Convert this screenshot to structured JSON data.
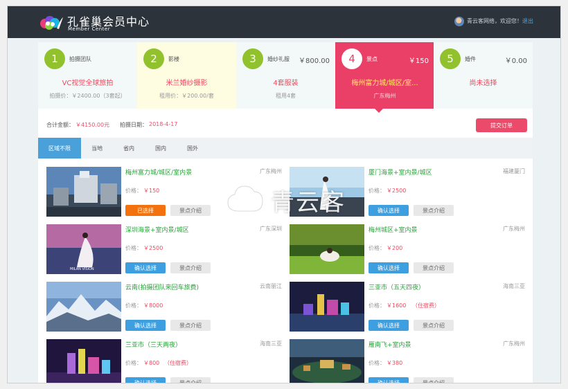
{
  "header": {
    "brand_title": "孔雀巢会员中心",
    "brand_sub": "Member Center",
    "welcome": "青云客网络，欢迎您！",
    "logout": "退出"
  },
  "steps": [
    {
      "num": "1",
      "title": "拍摄团队",
      "price": "",
      "selection": "VC视觉全球旅拍",
      "sub": "拍摄价：￥2400.00（3套起）",
      "color": "#91c12c",
      "bg": "#f2f9f8",
      "sel_color": "#e84b60"
    },
    {
      "num": "2",
      "title": "影楼",
      "price": "",
      "selection": "米兰婚纱摄影",
      "sub": "租用价：￥200.00/套",
      "color": "#91c12c",
      "bg": "#fefde1",
      "sel_color": "#e84b60"
    },
    {
      "num": "3",
      "title": "婚纱礼服",
      "price": "￥800.00",
      "selection": "4套服装",
      "sub": "租用4套",
      "color": "#91c12c",
      "bg": "#f2f9f8",
      "sel_color": "#e84b60"
    },
    {
      "num": "4",
      "title": "景点",
      "price": "￥150",
      "selection": "梅州富力城/城区/室...",
      "sub": "广东梅州",
      "color": "#ffffff",
      "bg": "#ea3f66",
      "sel_color": "#ffef5c"
    },
    {
      "num": "5",
      "title": "婚件",
      "price": "￥0.00",
      "selection": "尚未选择",
      "sub": "",
      "color": "#91c12c",
      "bg": "#f2f9f8",
      "sel_color": "#e84b60"
    }
  ],
  "summary": {
    "total_label": "合计金额：",
    "total_value": "￥4150.00元",
    "date_label": "拍摄日期：",
    "date_value": "2018-4-17",
    "submit_label": "提交订单"
  },
  "tabs": [
    "区域不限",
    "当地",
    "省内",
    "国内",
    "国外"
  ],
  "active_tab": 0,
  "price_label": "价格：",
  "confirm_label": "确认选择",
  "picked_label": "已选择",
  "intro_label": "景点介绍",
  "spots": [
    {
      "name": "梅州富力城/城区/室内景",
      "location": "广东梅州",
      "price": "￥150",
      "note": "",
      "picked": true
    },
    {
      "name": "厦门海景+室内景/城区",
      "location": "福建厦门",
      "price": "￥2500",
      "note": "",
      "picked": false
    },
    {
      "name": "深圳海景+室内景/城区",
      "location": "广东深圳",
      "price": "￥2500",
      "note": "",
      "picked": false
    },
    {
      "name": "梅州城区+室内景",
      "location": "广东梅州",
      "price": "￥200",
      "note": "",
      "picked": false
    },
    {
      "name": "云南(拍摄团队来回车旅费)",
      "location": "云南丽江",
      "price": "￥8000",
      "note": "",
      "picked": false
    },
    {
      "name": "三亚市（五天四夜）",
      "location": "海南三亚",
      "price": "￥1600",
      "note": "（住宿费）",
      "picked": false
    },
    {
      "name": "三亚市（三天两夜）",
      "location": "海南三亚",
      "price": "￥800",
      "note": "（住宿费）",
      "picked": false
    },
    {
      "name": "雁南飞+室内景",
      "location": "广东梅州",
      "price": "￥380",
      "note": "",
      "picked": false
    }
  ],
  "thumb_photo_text": "MILAN VISION",
  "watermark_text": "青云客",
  "colors": {
    "green": "#91c12c",
    "pink": "#ea3f66",
    "blue": "#3d9ee0",
    "orange": "#f4720d",
    "topbar": "#2c333b"
  }
}
